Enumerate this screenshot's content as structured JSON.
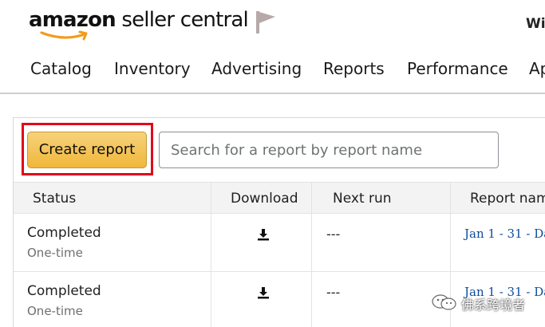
{
  "header": {
    "logo_brand": "amazon",
    "logo_suffix": " seller central",
    "user_name": "Wi"
  },
  "nav": {
    "items": [
      "Catalog",
      "Inventory",
      "Advertising",
      "Reports",
      "Performance",
      "Ap"
    ]
  },
  "toolbar": {
    "create_report_label": "Create report",
    "search_placeholder": "Search for a report by report name"
  },
  "table": {
    "columns": [
      "Status",
      "Download",
      "Next run",
      "Report nam"
    ],
    "rows": [
      {
        "status": "Completed",
        "frequency": "One-time",
        "next_run": "---",
        "report_name": "Jan 1 - 31 - Da"
      },
      {
        "status": "Completed",
        "frequency": "One-time",
        "next_run": "---",
        "report_name": "Jan 1 - 31 - Da"
      }
    ]
  },
  "watermark": {
    "text": "佛系跨境者"
  },
  "colors": {
    "accent_button": "#f0b73a",
    "highlight_border": "#e3001b",
    "link": "#0f4c9b",
    "logo_smile": "#f29b1d"
  },
  "icons": [
    "amazon-smile-icon",
    "flag-icon",
    "download-icon",
    "wechat-icon"
  ]
}
